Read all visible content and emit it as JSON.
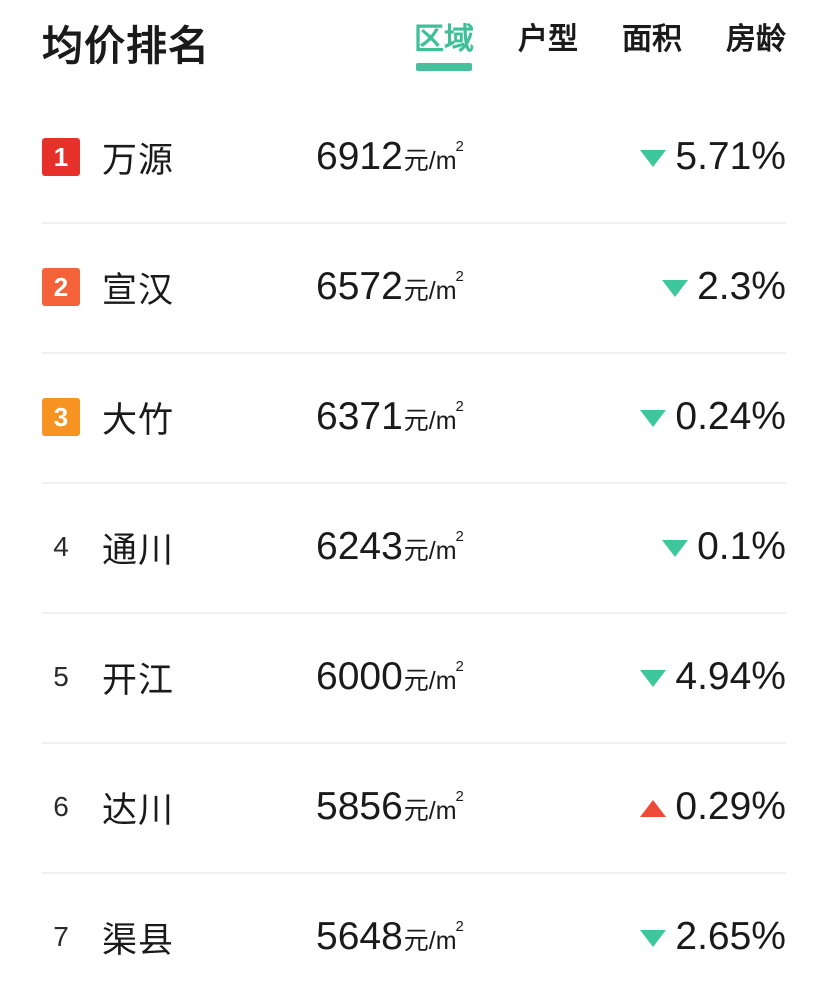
{
  "header": {
    "title": "均价排名",
    "tabs": [
      {
        "label": "区域",
        "active": true
      },
      {
        "label": "户型",
        "active": false
      },
      {
        "label": "面积",
        "active": false
      },
      {
        "label": "房龄",
        "active": false
      }
    ]
  },
  "colors": {
    "accent_green": "#45bf9c",
    "rank1_badge": "#e8302a",
    "rank2_badge": "#f4623a",
    "rank3_badge": "#f79421",
    "down_triangle": "#3fc79c",
    "up_triangle": "#ef4a37",
    "text_primary": "#1a1a1a",
    "divider": "#f0f0f0"
  },
  "price_unit": {
    "currency": "元/m",
    "superscript": "2"
  },
  "rows": [
    {
      "rank": "1",
      "rank_style": "badge",
      "badge_color": "#e8302a",
      "name": "万源",
      "price": "6912",
      "unit": "元/m",
      "unit_sup": "2",
      "change": "5.71%",
      "direction": "down"
    },
    {
      "rank": "2",
      "rank_style": "badge",
      "badge_color": "#f4623a",
      "name": "宣汉",
      "price": "6572",
      "unit": "元/m",
      "unit_sup": "2",
      "change": "2.3%",
      "direction": "down"
    },
    {
      "rank": "3",
      "rank_style": "badge",
      "badge_color": "#f79421",
      "name": "大竹",
      "price": "6371",
      "unit": "元/m",
      "unit_sup": "2",
      "change": "0.24%",
      "direction": "down"
    },
    {
      "rank": "4",
      "rank_style": "plain",
      "badge_color": "",
      "name": "通川",
      "price": "6243",
      "unit": "元/m",
      "unit_sup": "2",
      "change": "0.1%",
      "direction": "down"
    },
    {
      "rank": "5",
      "rank_style": "plain",
      "badge_color": "",
      "name": "开江",
      "price": "6000",
      "unit": "元/m",
      "unit_sup": "2",
      "change": "4.94%",
      "direction": "down"
    },
    {
      "rank": "6",
      "rank_style": "plain",
      "badge_color": "",
      "name": "达川",
      "price": "5856",
      "unit": "元/m",
      "unit_sup": "2",
      "change": "0.29%",
      "direction": "up"
    },
    {
      "rank": "7",
      "rank_style": "plain",
      "badge_color": "",
      "name": "渠县",
      "price": "5648",
      "unit": "元/m",
      "unit_sup": "2",
      "change": "2.65%",
      "direction": "down"
    }
  ]
}
